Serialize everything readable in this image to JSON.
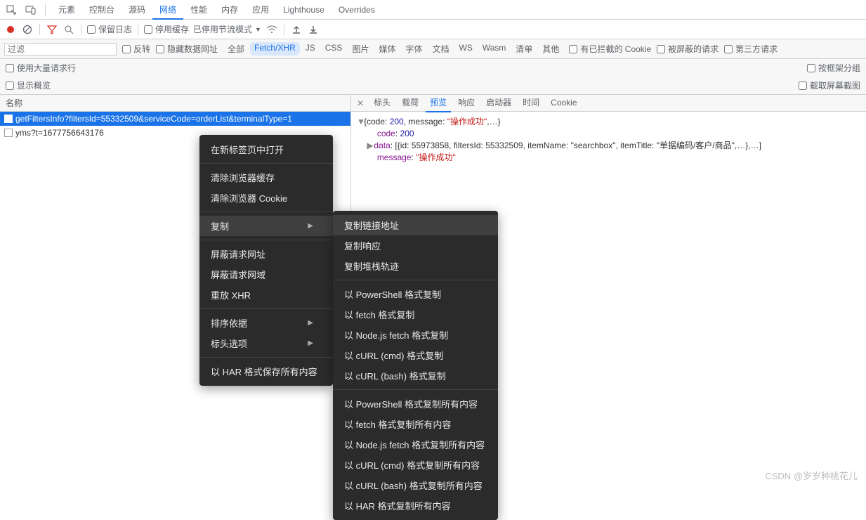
{
  "tabs": [
    "元素",
    "控制台",
    "源码",
    "网络",
    "性能",
    "内存",
    "应用",
    "Lighthouse",
    "Overrides"
  ],
  "active_tab_index": 3,
  "toolbar": {
    "preserve_log": "保留日志",
    "disable_cache": "停用缓存",
    "throttle": "已停用节流模式"
  },
  "filterbar": {
    "placeholder": "过滤",
    "invert": "反转",
    "hide_data_urls": "隐藏数据网址",
    "types": [
      "全部",
      "Fetch/XHR",
      "JS",
      "CSS",
      "图片",
      "媒体",
      "字体",
      "文档",
      "WS",
      "Wasm",
      "清单",
      "其他"
    ],
    "active_type_index": 1,
    "blocked_cookies": "有已拦截的 Cookie",
    "blocked_requests": "被屏蔽的请求",
    "third_party": "第三方请求"
  },
  "optrows": {
    "big_rows": "使用大量请求行",
    "group_by_frame": "按框架分组",
    "show_overview": "显示概览",
    "capture_screenshots": "截取屏幕截图"
  },
  "left_header": "名称",
  "requests": [
    "getFiltersInfo?filtersId=55332509&serviceCode=orderList&terminalType=1",
    "yms?t=1677756643176"
  ],
  "selected_request_index": 0,
  "right_tabs": [
    "标头",
    "载荷",
    "预览",
    "响应",
    "启动器",
    "时间",
    "Cookie"
  ],
  "right_active_index": 2,
  "preview": {
    "line1_pre": "{code: ",
    "code": "200",
    "line1_mid": ", message: ",
    "msg": "\"操作成功\"",
    "line1_post": ",…}",
    "code_key": "code",
    "code_colon": ": ",
    "code_val": "200",
    "data_key": "data",
    "data_content": ": [{id: 55973858, filtersId: 55332509, itemName: \"searchbox\", itemTitle: \"单据编码/客户/商品\",…},…]",
    "message_key": "message",
    "message_colon": ": ",
    "message_val": "\"操作成功\""
  },
  "ctx1": {
    "open_new_tab": "在新标签页中打开",
    "clear_cache": "清除浏览器缓存",
    "clear_cookies": "清除浏览器 Cookie",
    "copy": "复制",
    "block_url": "屏蔽请求网址",
    "block_domain": "屏蔽请求网域",
    "replay_xhr": "重放 XHR",
    "sort_by": "排序依据",
    "header_options": "标头选项",
    "save_har": "以 HAR 格式保存所有内容"
  },
  "ctx2": [
    "复制链接地址",
    "复制响应",
    "复制堆栈轨迹",
    "以 PowerShell 格式复制",
    "以 fetch 格式复制",
    "以 Node.js fetch 格式复制",
    "以 cURL (cmd) 格式复制",
    "以 cURL (bash) 格式复制",
    "以 PowerShell 格式复制所有内容",
    "以 fetch 格式复制所有内容",
    "以 Node.js fetch 格式复制所有内容",
    "以 cURL (cmd) 格式复制所有内容",
    "以 cURL (bash) 格式复制所有内容",
    "以 HAR 格式复制所有内容"
  ],
  "watermark": "CSDN @岁岁种桃花儿"
}
